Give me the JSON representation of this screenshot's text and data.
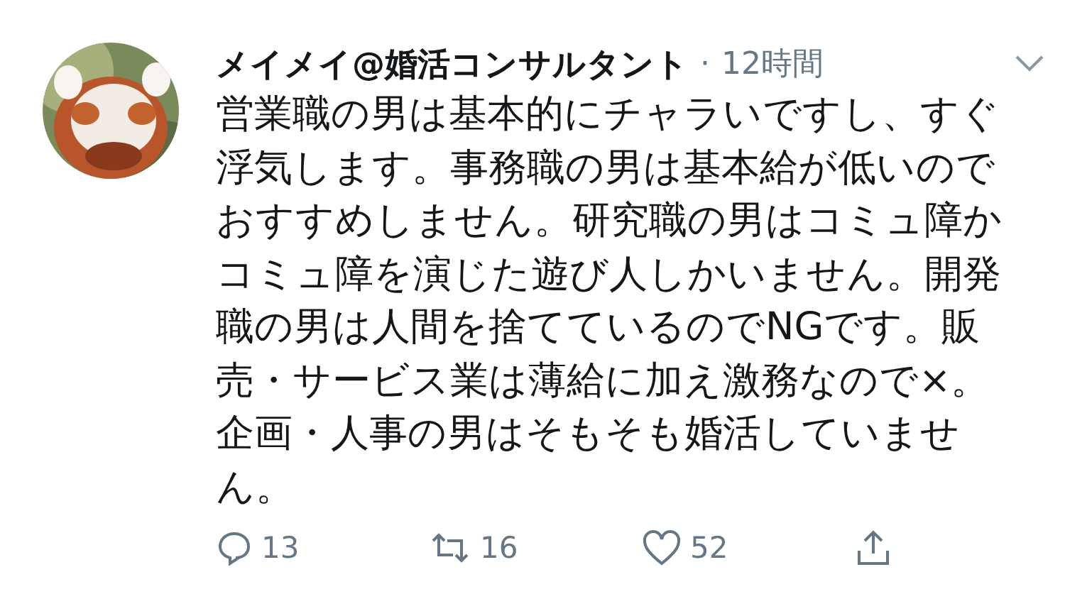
{
  "tweet": {
    "author": "メイメイ@婚活コンサルタント",
    "separator": "·",
    "time": "12時間",
    "menu": {
      "kind": "chevron"
    },
    "text": "営業職の男は基本的にチャラいですし、すぐ浮気します。事務職の男は基本給が低いのでおすすめしません。研究職の男はコミュ障かコミュ障を演じた遊び人しかいません。開発職の男は人間を捨てているのでNGです。販売・サービス業は薄給に加え激務なので×。企画・人事の男はそもそも婚活していません。",
    "actions": [
      {
        "kind": "reply",
        "count": "13"
      },
      {
        "kind": "retweet",
        "count": "16"
      },
      {
        "kind": "like",
        "count": "52"
      },
      {
        "kind": "share"
      }
    ]
  }
}
